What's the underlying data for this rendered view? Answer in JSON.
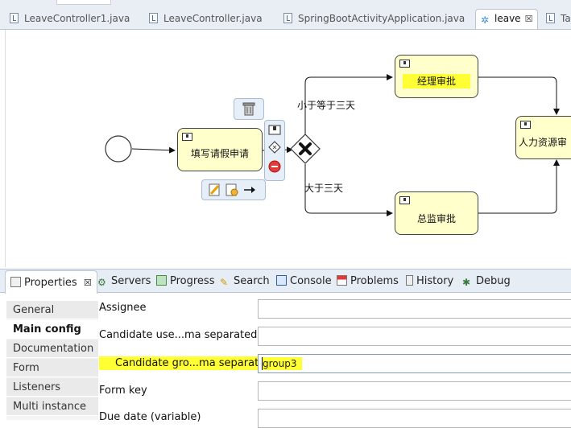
{
  "editor_tabs": [
    {
      "label": "LeaveController1.java"
    },
    {
      "label": "LeaveController.java"
    },
    {
      "label": "SpringBootActivityApplication.java"
    },
    {
      "label": "leave",
      "close": "☒"
    },
    {
      "label": "Ta"
    }
  ],
  "diagram": {
    "task_fill": "填写请假申请",
    "task_manager": "经理审批",
    "task_director": "总监审批",
    "task_hr": "人力资源审",
    "cond_le3": "小于等于三天",
    "cond_gt3": "大于三天",
    "highlight_color": "#ffff33"
  },
  "view_tabs": {
    "properties": "Properties",
    "properties_close": "☒",
    "servers": "Servers",
    "progress": "Progress",
    "search": "Search",
    "console": "Console",
    "problems": "Problems",
    "history": "History",
    "debug": "Debug"
  },
  "properties": {
    "sections": [
      "General",
      "Main config",
      "Documentation",
      "Form",
      "Listeners",
      "Multi instance"
    ],
    "active_section": "Main config",
    "fields": [
      {
        "label": "Assignee",
        "value": ""
      },
      {
        "label": "Candidate use...ma separated)",
        "value": ""
      },
      {
        "label": "Candidate gro...ma separated)",
        "value": "group3"
      },
      {
        "label": "Form key",
        "value": ""
      },
      {
        "label": "Due date (variable)",
        "value": ""
      }
    ]
  }
}
